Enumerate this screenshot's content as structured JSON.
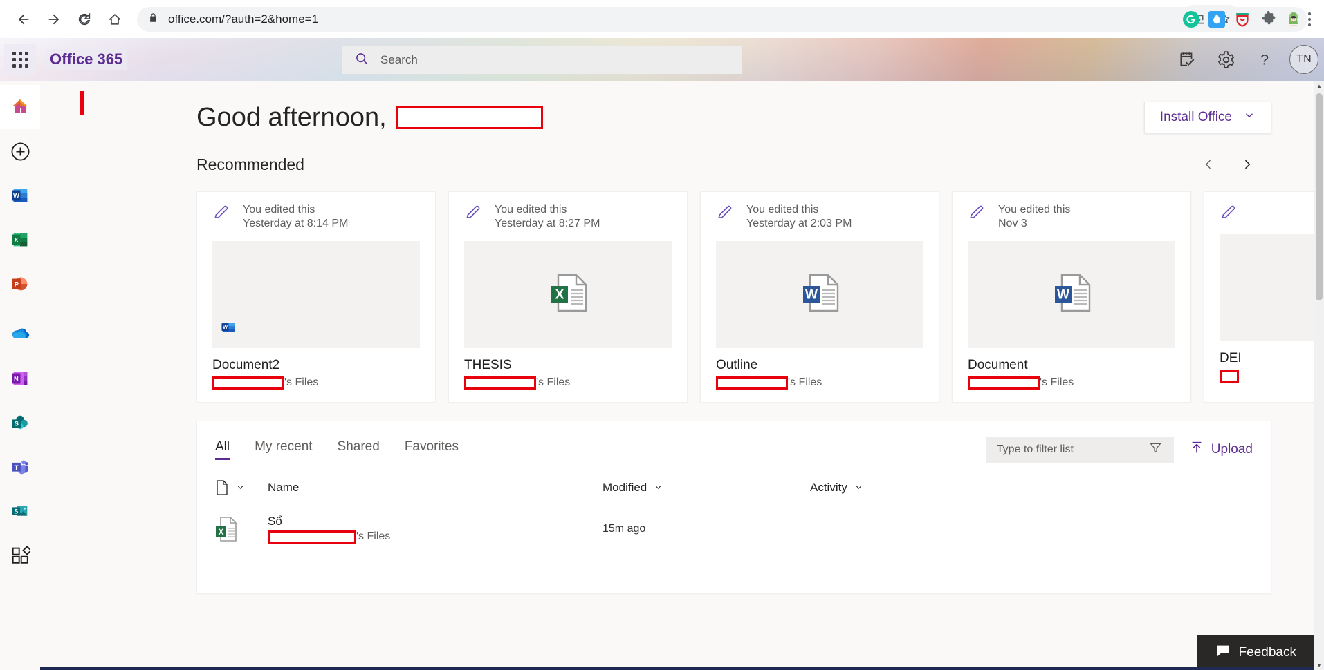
{
  "browser": {
    "url": "office.com/?auth=2&home=1",
    "back_label": "Back",
    "forward_label": "Forward",
    "reload_label": "Reload",
    "home_label": "Home",
    "lock_icon": "lock-icon",
    "install_icon": "install-app-icon",
    "bookmark_icon": "star-icon",
    "extensions": [
      {
        "name": "grammarly-extension",
        "label": "G"
      },
      {
        "name": "water-drop-extension",
        "label": ""
      },
      {
        "name": "pocket-shield-extension",
        "label": ""
      },
      {
        "name": "extensions-puzzle-icon",
        "label": ""
      },
      {
        "name": "profile-avatar-extension",
        "label": ""
      }
    ],
    "menu_icon": "three-dot-menu-icon"
  },
  "header": {
    "waffle_label": "App launcher",
    "brand": "Office 365",
    "search": {
      "placeholder": "Search",
      "icon": "search-icon"
    },
    "actions": [
      {
        "name": "tasks-icon",
        "label": "Tasks"
      },
      {
        "name": "gear-icon",
        "label": "Settings"
      },
      {
        "name": "help-icon",
        "label": "?"
      }
    ],
    "avatar_initials": "TN"
  },
  "rail": {
    "items": [
      {
        "name": "sidebar-item-home",
        "label": "Home",
        "icon": "home-icon",
        "active": true
      },
      {
        "name": "sidebar-item-create",
        "label": "Create",
        "icon": "plus-circle-icon"
      },
      {
        "name": "sidebar-item-word",
        "label": "Word",
        "icon": "word-icon"
      },
      {
        "name": "sidebar-item-excel",
        "label": "Excel",
        "icon": "excel-icon"
      },
      {
        "name": "sidebar-item-powerpoint",
        "label": "PowerPoint",
        "icon": "powerpoint-icon"
      },
      {
        "name": "sidebar-item-onedrive",
        "label": "OneDrive",
        "icon": "onedrive-icon"
      },
      {
        "name": "sidebar-item-onenote",
        "label": "OneNote",
        "icon": "onenote-icon"
      },
      {
        "name": "sidebar-item-sharepoint",
        "label": "SharePoint",
        "icon": "sharepoint-icon"
      },
      {
        "name": "sidebar-item-teams",
        "label": "Teams",
        "icon": "teams-icon"
      },
      {
        "name": "sidebar-item-sway",
        "label": "Sway",
        "icon": "sway-icon"
      },
      {
        "name": "sidebar-item-all-apps",
        "label": "All apps",
        "icon": "all-apps-icon"
      }
    ]
  },
  "main": {
    "greeting": "Good afternoon,",
    "greeting_name_redacted": true,
    "install_office": {
      "label": "Install Office",
      "chevron": "chevron-down-icon"
    },
    "recommended": {
      "title": "Recommended",
      "prev_icon": "chevron-left-icon",
      "next_icon": "chevron-right-icon",
      "cards": [
        {
          "activity": "You edited this",
          "time": "Yesterday at 8:14 PM",
          "title": "Document2",
          "owner_suffix": "'s Files",
          "app": "word",
          "thumb": "blank"
        },
        {
          "activity": "You edited this",
          "time": "Yesterday at 8:27 PM",
          "title": "THESIS",
          "owner_suffix": "'s Files",
          "app": "excel",
          "thumb": "page"
        },
        {
          "activity": "You edited this",
          "time": "Yesterday at 2:03 PM",
          "title": "Outline",
          "owner_suffix": "'s Files",
          "app": "word",
          "thumb": "page"
        },
        {
          "activity": "You edited this",
          "time": "Nov 3",
          "title": "Document",
          "owner_suffix": "'s Files",
          "app": "word",
          "thumb": "page"
        },
        {
          "activity": "",
          "time": "",
          "title": "DEI",
          "owner_suffix": "",
          "app": "word",
          "thumb": "page"
        }
      ]
    },
    "files": {
      "tabs": [
        {
          "label": "All",
          "active": true
        },
        {
          "label": "My recent",
          "active": false
        },
        {
          "label": "Shared",
          "active": false
        },
        {
          "label": "Favorites",
          "active": false
        }
      ],
      "filter": {
        "placeholder": "Type to filter list",
        "icon": "filter-funnel-icon"
      },
      "upload": {
        "label": "Upload",
        "icon": "upload-arrow-icon"
      },
      "columns": {
        "icon": "file-type-icon",
        "name": "Name",
        "modified": "Modified",
        "activity": "Activity"
      },
      "rows": [
        {
          "name": "Sổ",
          "owner_suffix": "'s Files",
          "modified": "15m ago",
          "activity": "",
          "app": "excel"
        }
      ]
    },
    "feedback": {
      "label": "Feedback",
      "icon": "feedback-icon"
    }
  },
  "colors": {
    "accent_purple": "#5b2d90",
    "redaction_red": "#e8000d",
    "word_blue": "#2b579a",
    "excel_green": "#217346",
    "page_bg": "#faf9f8"
  }
}
